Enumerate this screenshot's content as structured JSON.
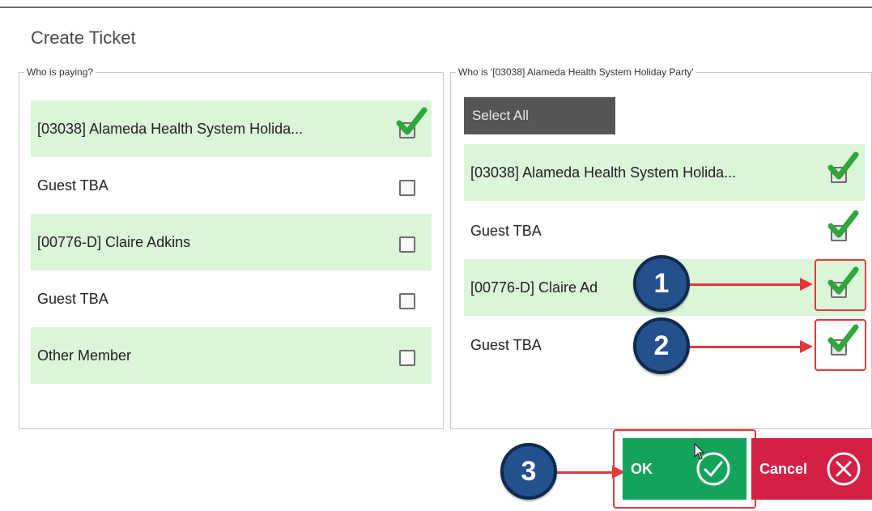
{
  "dialog": {
    "title": "Create Ticket"
  },
  "left_panel": {
    "legend": "Who is paying?",
    "rows": [
      {
        "label": "[03038]  Alameda Health System Holida...",
        "checked": true,
        "shaded": true
      },
      {
        "label": "Guest TBA",
        "checked": false,
        "shaded": false
      },
      {
        "label": "[00776-D] Claire Adkins",
        "checked": false,
        "shaded": true
      },
      {
        "label": "Guest TBA",
        "checked": false,
        "shaded": false
      },
      {
        "label": "Other Member",
        "checked": false,
        "shaded": true
      }
    ]
  },
  "right_panel": {
    "legend": "Who is '[03038]  Alameda Health System Holiday Party'",
    "select_all_label": "Select All",
    "rows": [
      {
        "label": "[03038]  Alameda Health System Holida...",
        "checked": true,
        "shaded": true
      },
      {
        "label": "Guest TBA",
        "checked": true,
        "shaded": false
      },
      {
        "label": "[00776-D] Claire Ad",
        "checked": true,
        "shaded": true
      },
      {
        "label": "Guest TBA",
        "checked": true,
        "shaded": false
      }
    ]
  },
  "annotations": {
    "badges": [
      "1",
      "2",
      "3"
    ],
    "color": "#e03a3a",
    "badge_color": "#24508d"
  },
  "buttons": {
    "ok_label": "OK",
    "cancel_label": "Cancel",
    "ok_icon": "check-circle-icon",
    "cancel_icon": "x-circle-icon",
    "ok_color": "#14a35a",
    "cancel_color": "#d51f44"
  },
  "colors": {
    "row_shade": "#dbf5d9",
    "check_green": "#2ea63a"
  }
}
